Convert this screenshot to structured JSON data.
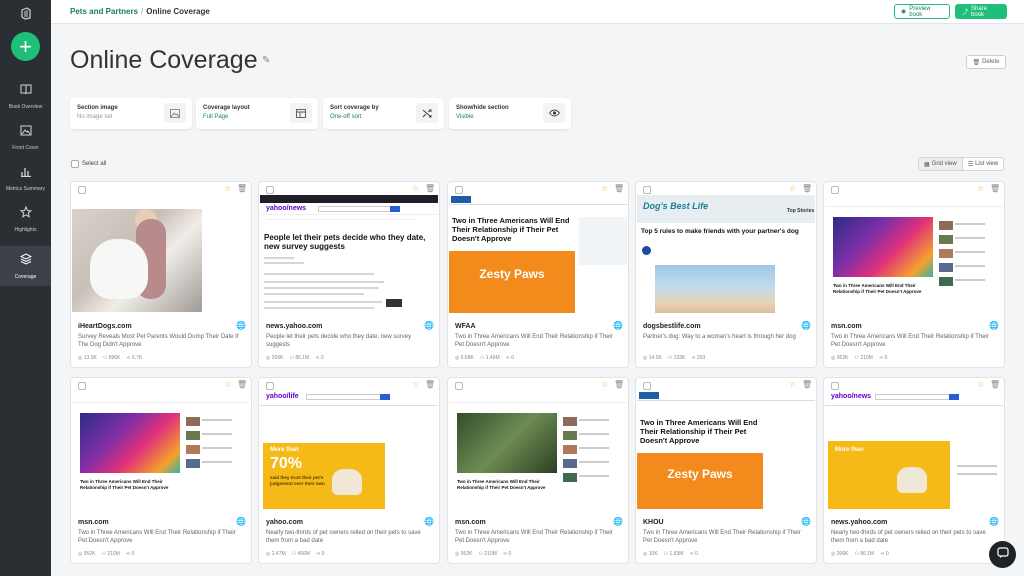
{
  "breadcrumb": {
    "parent": "Pets and Partners",
    "separator": "/",
    "current": "Online Coverage"
  },
  "header": {
    "preview_label": "Preview book",
    "share_label": "Share book"
  },
  "sidebar": {
    "items": [
      {
        "label": "Book Overview",
        "icon": "book-icon"
      },
      {
        "label": "Front Cover",
        "icon": "image-icon"
      },
      {
        "label": "Metrics Summary",
        "icon": "bar-chart-icon"
      },
      {
        "label": "Highlights",
        "icon": "star-icon"
      },
      {
        "label": "Coverage",
        "icon": "layers-icon",
        "active": true
      }
    ]
  },
  "page": {
    "title": "Online Coverage",
    "delete_label": "Delete"
  },
  "settings": [
    {
      "label": "Section image",
      "value": "No image set",
      "icon": "image-icon"
    },
    {
      "label": "Coverage layout",
      "value": "Full Page",
      "icon": "layout-icon"
    },
    {
      "label": "Sort coverage by",
      "value": "One-off sort",
      "icon": "shuffle-icon"
    },
    {
      "label": "Show/hide section",
      "value": "Visible",
      "icon": "eye-icon"
    }
  ],
  "toolbar": {
    "select_all": "Select all",
    "grid_view": "Grid view",
    "list_view": "List view"
  },
  "cards": [
    {
      "domain": "iHeartDogs.com",
      "desc": "Survey Reveals Most Pet Parents Would Dump Their Date If The Dog Didn't Approve",
      "stat1": "13.5K",
      "stat2": "896K",
      "stat3": "6.7K"
    },
    {
      "domain": "news.yahoo.com",
      "desc": "People let their pets decide who they date, new survey suggests",
      "stat1": "206K",
      "stat2": "86.1M",
      "stat3": "0",
      "thumb_headline": "People let their pets decide who they date, new survey suggests"
    },
    {
      "domain": "WFAA",
      "desc": "Two in Three Americans Will End Their Relationship if Their Pet Doesn't Approve",
      "stat1": "6.68K",
      "stat2": "1.49M",
      "stat3": "0",
      "thumb_headline": "Two in Three Americans Will End Their Relationship if Their Pet Doesn't Approve",
      "thumb_brand": "Zesty Paws"
    },
    {
      "domain": "dogsbestlife.com",
      "desc": "Partner's dog: Way to a woman's heart is through her dog",
      "stat1": "14.5K",
      "stat2": "132K",
      "stat3": "293",
      "thumb_logo": "Dog's Best Life",
      "thumb_headline": "Top 5 rules to make friends with your partner's dog"
    },
    {
      "domain": "msn.com",
      "desc": "Two in Three Americans Will End Their Relationship if Their Pet Doesn't Approve",
      "stat1": "952K",
      "stat2": "210M",
      "stat3": "0"
    },
    {
      "domain": "msn.com",
      "desc": "Two in Three Americans Will End Their Relationship if Their Pet Doesn't Approve",
      "stat1": "952K",
      "stat2": "210M",
      "stat3": "0"
    },
    {
      "domain": "yahoo.com",
      "desc": "Nearly two-thirds of pet owners relied on their pets to save them from a bad date",
      "stat1": "2.47M",
      "stat2": "466M",
      "stat3": "0",
      "thumb_big": "70%",
      "thumb_text": "said they trust their pet's judgement over their own"
    },
    {
      "domain": "msn.com",
      "desc": "Two in Three Americans Will End Their Relationship if Their Pet Doesn't Approve",
      "stat1": "952K",
      "stat2": "210M",
      "stat3": "0"
    },
    {
      "domain": "KHOU",
      "desc": "Two in Three Americans Will End Their Relationship if Their Pet Doesn't Approve",
      "stat1": "10K",
      "stat2": "1.83M",
      "stat3": "0",
      "thumb_headline": "Two in Three Americans Will End Their Relationship if Their Pet Doesn't Approve",
      "thumb_brand": "Zesty Paws"
    },
    {
      "domain": "news.yahoo.com",
      "desc": "Nearly two-thirds of pet owners relied on their pets to save them from a bad date",
      "stat1": "206K",
      "stat2": "86.1M",
      "stat3": "0",
      "thumb_big": "More than"
    }
  ],
  "thumb_misc": {
    "yahoo_news": "yahoo/news",
    "yahoo_life": "yahoo/life",
    "more_than": "More than",
    "top_stories": "Top Stories",
    "msn_headline": "Two in Three Americans Will End Their Relationship if Their Pet Doesn't Approve"
  },
  "colors": {
    "accent": "#1fbf7a",
    "sidebar": "#2a2f33",
    "star": "#e8a820"
  }
}
